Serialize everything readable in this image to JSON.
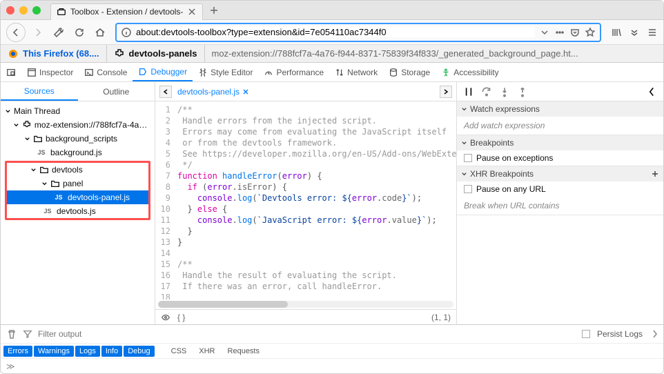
{
  "tab": {
    "title": "Toolbox - Extension / devtools-"
  },
  "url": "about:devtools-toolbox?type=extension&id=7e054110ac7344f0",
  "context": {
    "firefox_label": "This Firefox (68....",
    "panel_name": "devtools-panels",
    "panel_url": "moz-extension://788fcf7a-4a76-f944-8371-75839f34f833/_generated_background_page.ht..."
  },
  "toolbar": {
    "inspector": "Inspector",
    "console": "Console",
    "debugger": "Debugger",
    "style": "Style Editor",
    "performance": "Performance",
    "network": "Network",
    "storage": "Storage",
    "accessibility": "Accessibility"
  },
  "sidebar": {
    "sources_tab": "Sources",
    "outline_tab": "Outline",
    "main_thread": "Main Thread",
    "ext_label": "moz-extension://788fcf7a-4a76-",
    "bg_scripts": "background_scripts",
    "bg_js": "background.js",
    "devtools_folder": "devtools",
    "panel_folder": "panel",
    "panel_js": "devtools-panel.js",
    "devtools_js": "devtools.js"
  },
  "editor": {
    "active_file": "devtools-panel.js",
    "cursor": "(1, 1)",
    "lines": 18
  },
  "code_lines": [
    {
      "n": 1,
      "t": "comment",
      "txt": "/**"
    },
    {
      "n": 2,
      "t": "comment",
      "txt": " Handle errors from the injected script."
    },
    {
      "n": 3,
      "t": "comment",
      "txt": " Errors may come from evaluating the JavaScript itself"
    },
    {
      "n": 4,
      "t": "comment",
      "txt": " or from the devtools framework."
    },
    {
      "n": 5,
      "t": "comment",
      "txt": " See https://developer.mozilla.org/en-US/Add-ons/WebExtens"
    },
    {
      "n": 6,
      "t": "comment",
      "txt": " */"
    }
  ],
  "rightpane": {
    "watch_header": "Watch expressions",
    "watch_placeholder": "Add watch expression",
    "breakpoints_header": "Breakpoints",
    "pause_exceptions": "Pause on exceptions",
    "xhr_header": "XHR Breakpoints",
    "pause_url": "Pause on any URL",
    "break_url": "Break when URL contains"
  },
  "console": {
    "filter_placeholder": "Filter output",
    "persist": "Persist Logs",
    "tags": [
      "Errors",
      "Warnings",
      "Logs",
      "Info",
      "Debug"
    ],
    "plain_tags": [
      "CSS",
      "XHR",
      "Requests"
    ]
  }
}
